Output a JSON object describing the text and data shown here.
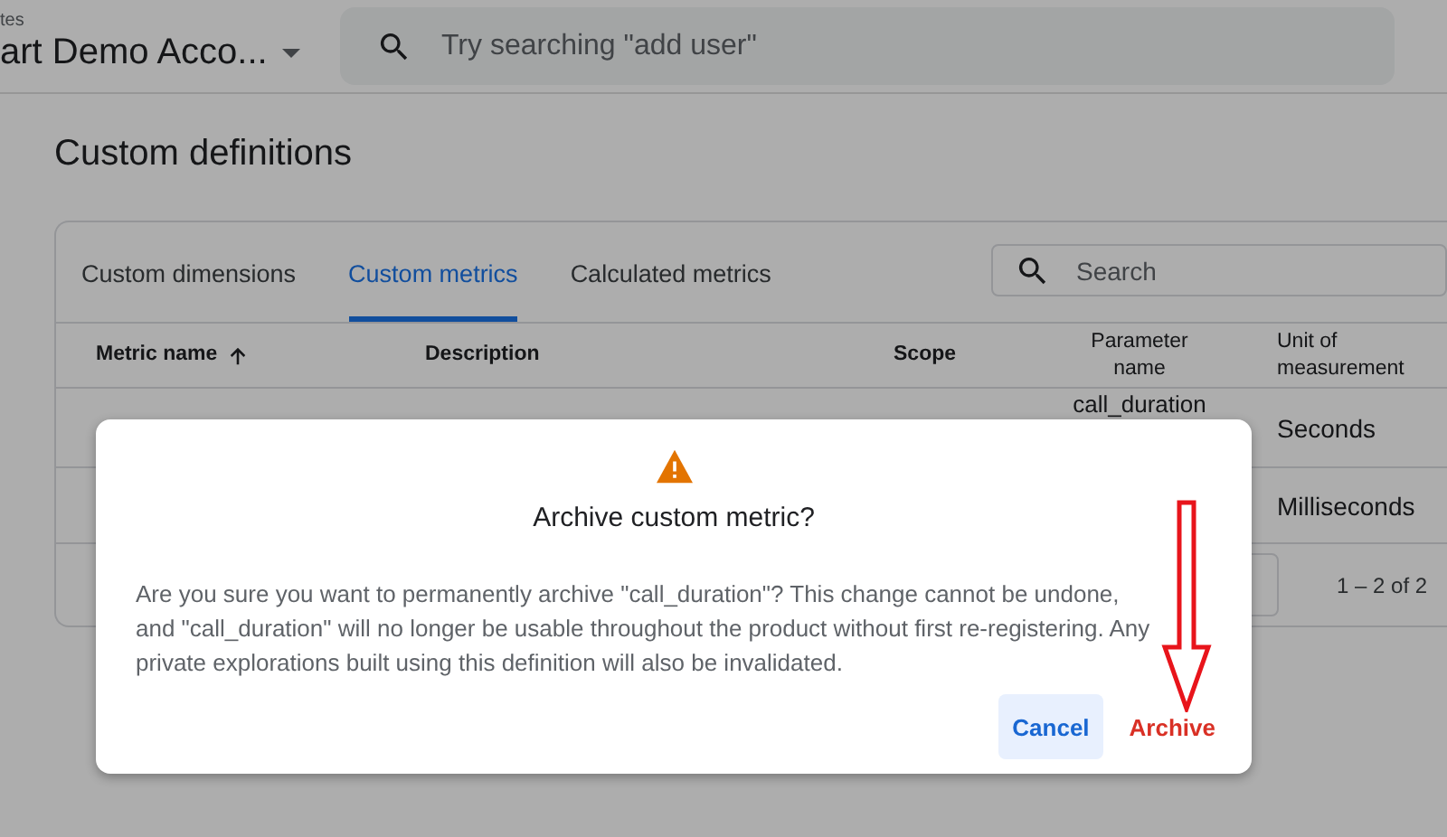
{
  "header": {
    "breadcrumb": "tes",
    "account": "art Demo Acco...",
    "search": {
      "placeholder": "Try searching \"add user\""
    }
  },
  "page_title": "Custom definitions",
  "tabs": [
    {
      "label": "Custom dimensions",
      "selected": false
    },
    {
      "label": "Custom metrics",
      "selected": true
    },
    {
      "label": "Calculated metrics",
      "selected": false
    }
  ],
  "table_search": {
    "placeholder": "Search"
  },
  "table": {
    "columns": [
      {
        "label": "Metric name",
        "sorted": true
      },
      {
        "label": "Description",
        "sorted": false
      },
      {
        "label": "Scope",
        "sorted": false
      },
      {
        "label": "Parameter name",
        "sorted": false
      },
      {
        "label": "Unit of measurement",
        "sorted": false
      }
    ],
    "rows": [
      {
        "parameter_name": "call_duration",
        "unit": "Seconds"
      },
      {
        "unit": "Milliseconds"
      }
    ],
    "pagination": "1 – 2 of 2"
  },
  "dialog": {
    "title": "Archive custom metric?",
    "body": "Are you sure you want to permanently archive \"call_duration\"? This change cannot be undone, and \"call_duration\" will no longer be usable throughout the product without first re-registering. Any private explorations built using this definition will also be invalidated.",
    "buttons": [
      {
        "label": "Cancel",
        "kind": "secondary"
      },
      {
        "label": "Archive",
        "kind": "destructive"
      }
    ]
  }
}
